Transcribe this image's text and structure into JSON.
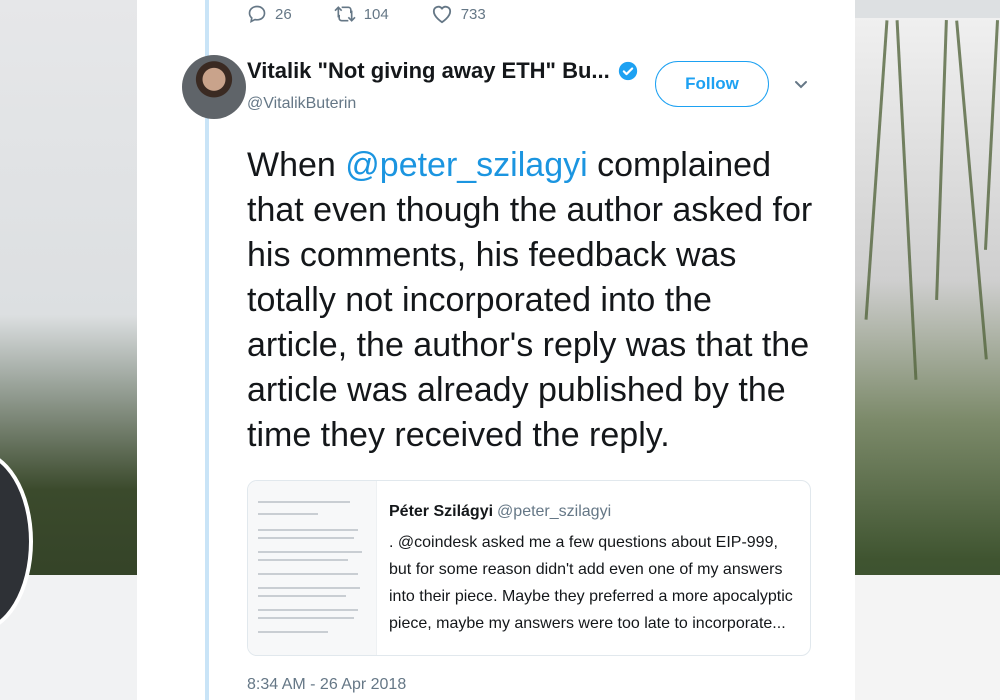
{
  "tweet": {
    "stats": {
      "replies": "26",
      "retweets": "104",
      "likes": "733"
    },
    "author": {
      "display_name": "Vitalik \"Not giving away ETH\" Bu...",
      "handle": "@VitalikButerin"
    },
    "follow_label": "Follow",
    "text_segments": {
      "before": "When ",
      "mention": "@peter_szilagyi",
      "after": " complained that even though the author asked for his comments, his feedback was totally not incorporated into the article, the author's reply was that the article was already published by the time they received the reply."
    },
    "quoted": {
      "name": "Péter Szilágyi",
      "handle": "@peter_szilagyi",
      "text": ". @coindesk asked me a few questions about EIP-999, but for some reason didn't add even one of my answers into their piece. Maybe they preferred a more apocalyptic piece, maybe my answers were too late to incorporate..."
    },
    "timestamp": "8:34 AM - 26 Apr 2018"
  },
  "colors": {
    "accent": "#1da1f2",
    "mention": "#1b95e0",
    "muted": "#657786",
    "thread_line": "#c9e4f7"
  },
  "icons": [
    "reply-icon",
    "retweet-icon",
    "like-icon",
    "verified-icon",
    "chevron-down-icon"
  ]
}
